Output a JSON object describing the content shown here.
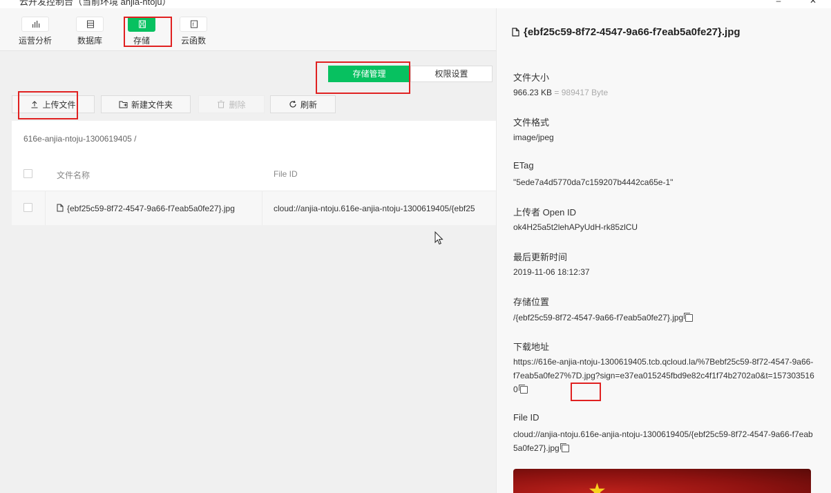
{
  "window": {
    "title": "云开发控制台（当前环境 anjia-ntoju）"
  },
  "nav": {
    "items": [
      {
        "label": "运营分析",
        "icon": "bar-chart-icon",
        "active": false
      },
      {
        "label": "数据库",
        "icon": "database-icon",
        "active": false
      },
      {
        "label": "存储",
        "icon": "storage-icon",
        "active": true
      },
      {
        "label": "云函数",
        "icon": "function-icon",
        "active": false
      }
    ]
  },
  "tabs": {
    "storage_manage": "存储管理",
    "permission": "权限设置"
  },
  "toolbar": {
    "upload": "上传文件",
    "new_folder": "新建文件夹",
    "delete": "删除",
    "refresh": "刷新"
  },
  "breadcrumb": "616e-anjia-ntoju-1300619405 /",
  "table": {
    "headers": {
      "name": "文件名称",
      "file_id": "File ID"
    },
    "rows": [
      {
        "name": "{ebf25c59-8f72-4547-9a66-f7eab5a0fe27}.jpg",
        "file_id": "cloud://anjia-ntoju.616e-anjia-ntoju-1300619405/{ebf25"
      }
    ]
  },
  "detail": {
    "title": "{ebf25c59-8f72-4547-9a66-f7eab5a0fe27}.jpg",
    "size_label": "文件大小",
    "size_value": "966.23 KB",
    "size_bytes": "= 989417 Byte",
    "format_label": "文件格式",
    "format_value": "image/jpeg",
    "etag_label": "ETag",
    "etag_value": "\"5ede7a4d5770da7c159207b4442ca65e-1\"",
    "uploader_label": "上传者 Open ID",
    "uploader_value": "ok4H25a5t2lehAPyUdH-rk85zlCU",
    "updated_label": "最后更新时间",
    "updated_value": "2019-11-06 18:12:37",
    "location_label": "存储位置",
    "location_value": "/{ebf25c59-8f72-4547-9a66-f7eab5a0fe27}.jpg",
    "download_label": "下载地址",
    "download_value": "https://616e-anjia-ntoju-1300619405.tcb.qcloud.la/%7Bebf25c59-8f72-4547-9a66-f7eab5a0fe27%7D.jpg?sign=e37ea015245fbd9e82c4f1f74b2702a0&t=1573035160",
    "fileid_label": "File ID",
    "fileid_value": "cloud://anjia-ntoju.616e-anjia-ntoju-1300619405/{ebf25c59-8f72-4547-9a66-f7eab5a0fe27}.jpg"
  },
  "colors": {
    "accent": "#07c160",
    "highlight": "#e02020"
  }
}
